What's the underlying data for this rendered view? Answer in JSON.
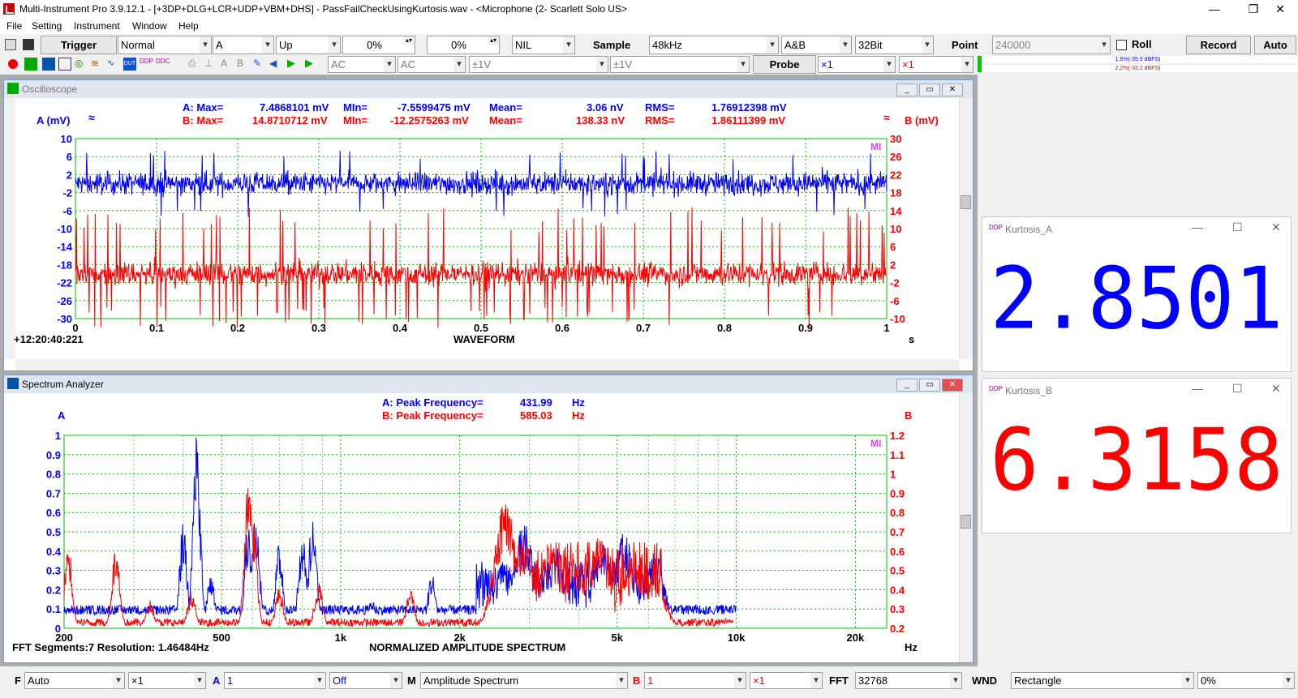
{
  "window": {
    "title": "Multi-Instrument Pro 3.9.12.1   -   [+3DP+DLG+LCR+UDP+VBM+DHS]   -   PassFailCheckUsingKurtosis.wav   -   <Microphone (2- Scarlett Solo US>",
    "minimize": "—",
    "maximize": "❐",
    "close": "✕"
  },
  "menu": [
    "File",
    "Setting",
    "Instrument",
    "Window",
    "Help"
  ],
  "toolbar1": {
    "trigger_label": "Trigger",
    "trigger_mode": "Normal",
    "trigger_channel": "A",
    "trigger_edge": "Up",
    "trigger_level": "0%",
    "trigger_delay": "0%",
    "trigger_nil": "NIL",
    "sample_label": "Sample",
    "sample_rate": "48kHz",
    "channels": "A&B",
    "bits": "32Bit",
    "point_label": "Point",
    "points": "240000",
    "roll_label": "Roll",
    "record_label": "Record",
    "auto_label": "Auto"
  },
  "toolbar2": {
    "coupling_a": "AC",
    "coupling_b": "AC",
    "range_a": "±1V",
    "range_b": "±1V",
    "probe_label": "Probe",
    "probe_a": "×1",
    "probe_b": "×1",
    "meter_a": "1.6%(-35.9 dBFS)",
    "meter_b": "2.2%(-33.2 dBFS)"
  },
  "oscilloscope": {
    "title": "Oscilloscope",
    "a_label": "A (mV)",
    "b_label": "B (mV)",
    "a_stats": {
      "max_label": "A: Max=",
      "max": "7.4868101 mV",
      "min_label": "MIn=",
      "min": "-7.5599475 mV",
      "mean_label": "Mean=",
      "mean": "3.06  nV",
      "rms_label": "RMS=",
      "rms": "1.76912398 mV"
    },
    "b_stats": {
      "max_label": "B: Max=",
      "max": "14.8710712 mV",
      "min_label": "MIn=",
      "min": "-12.2575263 mV",
      "mean_label": "Mean=",
      "mean": "138.33  nV",
      "rms_label": "RMS=",
      "rms": "1.86111399 mV"
    },
    "timestamp": "+12:20:40:221",
    "xlabel": "WAVEFORM",
    "xunit": "s",
    "mi_logo": "MI"
  },
  "spectrum": {
    "title": "Spectrum Analyzer",
    "a_label": "A",
    "b_label": "B",
    "a_peak_label": "A: Peak Frequency=",
    "a_peak": "431.99",
    "b_peak_label": "B: Peak Frequency=",
    "b_peak": "585.03",
    "unit": "Hz",
    "fft_info": "FFT Segments:7   Resolution: 1.46484Hz",
    "xlabel": "NORMALIZED AMPLITUDE SPECTRUM",
    "xunit": "Hz",
    "mi_logo": "MI"
  },
  "kurtosis_a": {
    "title": "Kurtosis_A",
    "value": "2.8501",
    "color": "#0000ff"
  },
  "kurtosis_b": {
    "title": "Kurtosis_B",
    "value": "6.3158",
    "color": "#ff0000"
  },
  "bottom": {
    "f_label": "F",
    "f_mode": "Auto",
    "f_mult": "×1",
    "a_label": "A",
    "a_val": "1",
    "a_off": "Off",
    "m_label": "M",
    "m_val": "Amplitude Spectrum",
    "b_label": "B",
    "b_val": "1",
    "b_mult": "×1",
    "fft_label": "FFT",
    "fft_val": "32768",
    "wnd_label": "WND",
    "wnd_val": "Rectangle",
    "wnd_pct": "0%"
  },
  "chart_data": [
    {
      "type": "line",
      "title": "WAVEFORM",
      "xlabel": "s",
      "ylabel_left": "A (mV)",
      "ylabel_right": "B (mV)",
      "x_ticks": [
        "0",
        "0.1",
        "0.2",
        "0.3",
        "0.4",
        "0.5",
        "0.6",
        "0.7",
        "0.8",
        "0.9",
        "1"
      ],
      "y_left_ticks": [
        "10",
        "6",
        "2",
        "-2",
        "-6",
        "-10",
        "-14",
        "-18",
        "-22",
        "-26",
        "-30"
      ],
      "y_right_ticks": [
        "30",
        "26",
        "22",
        "18",
        "14",
        "10",
        "6",
        "2",
        "-2",
        "-6",
        "-10"
      ],
      "xlim": [
        0,
        1
      ],
      "ylim_left": [
        -30,
        10
      ],
      "ylim_right": [
        -10,
        30
      ],
      "grid": true,
      "series": [
        {
          "name": "A",
          "color": "#0000ff",
          "axis": "left",
          "center": 0,
          "max": 7.4868101,
          "min": -7.5599475,
          "rms": 1.76912398
        },
        {
          "name": "B",
          "color": "#ff0000",
          "axis": "right",
          "center": 0,
          "max": 14.8710712,
          "min": -12.2575263,
          "rms": 1.86111399
        }
      ]
    },
    {
      "type": "line",
      "title": "NORMALIZED AMPLITUDE SPECTRUM",
      "xlabel": "Hz",
      "x_scale": "log",
      "x_ticks": [
        "200",
        "500",
        "1k",
        "2k",
        "5k",
        "10k",
        "20k"
      ],
      "y_left_ticks": [
        "1",
        "0.9",
        "0.8",
        "0.7",
        "0.6",
        "0.5",
        "0.4",
        "0.3",
        "0.2",
        "0.1",
        "0"
      ],
      "y_right_ticks": [
        "1.2",
        "1.1",
        "1",
        "0.9",
        "0.8",
        "0.7",
        "0.6",
        "0.5",
        "0.4",
        "0.3",
        "0.2"
      ],
      "xlim": [
        200,
        24000
      ],
      "ylim_left": [
        0,
        1
      ],
      "ylim_right": [
        0.2,
        1.2
      ],
      "grid": true,
      "series": [
        {
          "name": "A",
          "color": "#0000ff",
          "peaks": [
            [
              210,
              0.1
            ],
            [
              300,
              0.12
            ],
            [
              431.99,
              1.0
            ],
            [
              400,
              0.55
            ],
            [
              470,
              0.3
            ],
            [
              585,
              0.55
            ],
            [
              610,
              0.6
            ],
            [
              700,
              0.45
            ],
            [
              800,
              0.5
            ],
            [
              850,
              0.62
            ],
            [
              1200,
              0.15
            ],
            [
              1700,
              0.3
            ],
            [
              2600,
              0.3
            ],
            [
              2900,
              0.55
            ],
            [
              3500,
              0.42
            ],
            [
              4600,
              0.45
            ],
            [
              5200,
              0.5
            ],
            [
              6200,
              0.4
            ],
            [
              7300,
              0.12
            ],
            [
              8800,
              0.1
            ],
            [
              9400,
              0.08
            ]
          ]
        },
        {
          "name": "B",
          "color": "#ff0000",
          "peaks": [
            [
              205,
              0.46
            ],
            [
              270,
              0.42
            ],
            [
              330,
              0.15
            ],
            [
              420,
              0.2
            ],
            [
              585.03,
              0.8
            ],
            [
              600,
              0.62
            ],
            [
              700,
              0.22
            ],
            [
              880,
              0.25
            ],
            [
              1500,
              0.22
            ],
            [
              2600,
              0.7
            ],
            [
              2900,
              0.5
            ],
            [
              3400,
              0.45
            ],
            [
              3900,
              0.35
            ],
            [
              4500,
              0.48
            ],
            [
              5500,
              0.32
            ],
            [
              6200,
              0.28
            ],
            [
              9800,
              0.05
            ]
          ]
        }
      ]
    }
  ]
}
